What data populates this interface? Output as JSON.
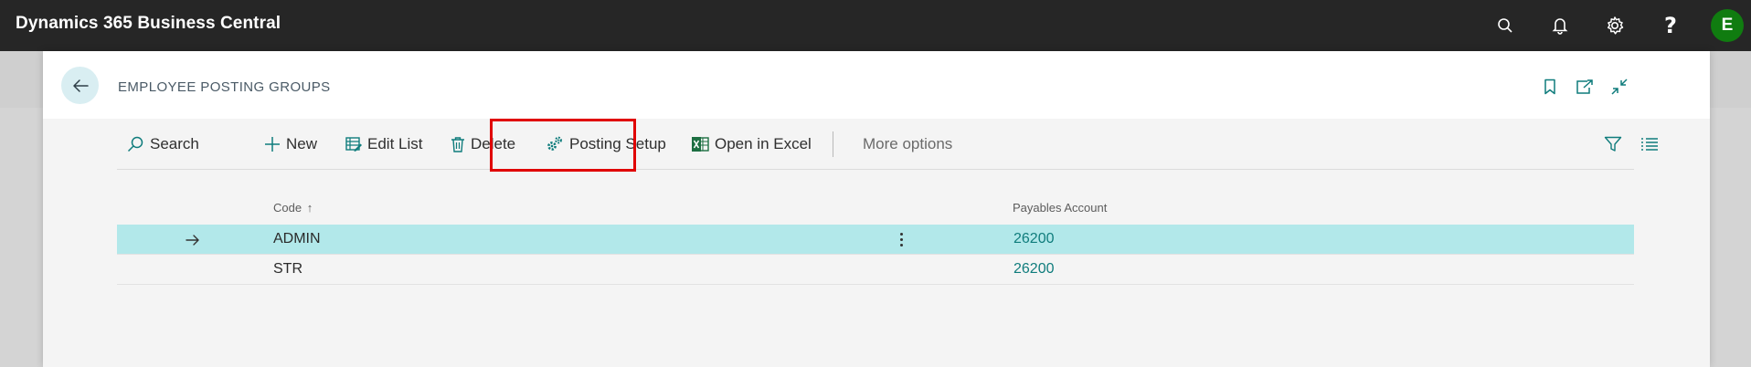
{
  "app": {
    "title": "Dynamics 365 Business Central",
    "avatar_initial": "E"
  },
  "page": {
    "title": "EMPLOYEE POSTING GROUPS"
  },
  "actions": {
    "search": "Search",
    "new": "New",
    "edit_list": "Edit List",
    "delete": "Delete",
    "posting_setup": "Posting Setup",
    "open_in_excel": "Open in Excel",
    "more_options": "More options"
  },
  "table": {
    "columns": {
      "code": "Code",
      "payables_account": "Payables Account"
    },
    "sort_indicator": "↑",
    "rows": [
      {
        "code": "ADMIN",
        "payables_account": "26200",
        "selected": true
      },
      {
        "code": "STR",
        "payables_account": "26200",
        "selected": false
      }
    ]
  },
  "colors": {
    "app_bar": "#262626",
    "accent": "#0f7c7c",
    "selected_row": "#b2e8ea",
    "avatar": "#107c10",
    "highlight": "#e00000"
  },
  "icons": {
    "appbar": [
      "search-icon",
      "bell-icon",
      "gear-icon",
      "help-icon"
    ],
    "header": [
      "bookmark-icon",
      "share-icon",
      "collapse-icon"
    ],
    "actionbar_right": [
      "filter-icon",
      "list-view-icon"
    ]
  }
}
